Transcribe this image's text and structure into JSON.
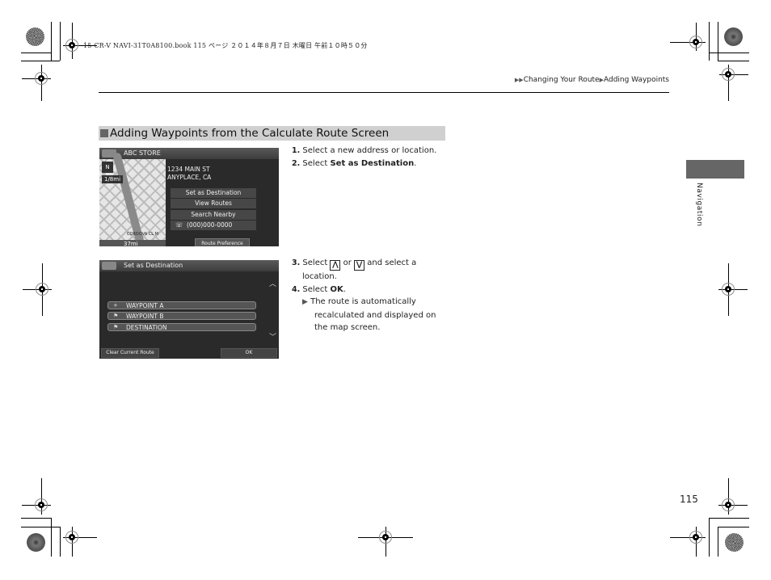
{
  "print_slug": "15 CR-V NAVI-31T0A8100.book  115 ページ  ２０１４年８月７日  木曜日  午前１０時５０分",
  "breadcrumb": {
    "items": [
      "Changing Your Route",
      "Adding Waypoints"
    ]
  },
  "section": {
    "title": "Adding Waypoints from the Calculate Route Screen"
  },
  "screen1": {
    "header_title": "ABC STORE",
    "map": {
      "north_label": "N",
      "zoom_scale": "1/8mi",
      "street_name": "CORDOVA CL M",
      "bottom_scale": "37mi"
    },
    "address_line1": "1234 MAIN ST",
    "address_line2": "ANYPLACE, CA",
    "menu": [
      {
        "label": "Set as Destination"
      },
      {
        "label": "View Routes"
      },
      {
        "label": "Search Nearby"
      },
      {
        "label": "(000)000-0000",
        "icon": "phone-icon"
      }
    ],
    "route_preference_label": "Route Preference"
  },
  "screen2": {
    "header_title": "Set as Destination",
    "list": [
      {
        "label": "WAYPOINT A",
        "icon": "+"
      },
      {
        "label": "WAYPOINT B",
        "icon": "flag"
      },
      {
        "label": "DESTINATION",
        "icon": "flag"
      }
    ],
    "clear_route_label": "Clear Current Route",
    "ok_label": "OK"
  },
  "steps_block1": {
    "step1_num": "1.",
    "step1_text": "Select a new address or location.",
    "step2_num": "2.",
    "step2_prefix": "Select ",
    "step2_bold": "Set as Destination",
    "step2_suffix": "."
  },
  "steps_block2": {
    "step3_num": "3.",
    "step3_prefix": "Select",
    "step3_up_key": "⋀",
    "step3_or": "or",
    "step3_down_key": "⋁",
    "step3_suffix": "and select a",
    "step3_line2": "location.",
    "step4_num": "4.",
    "step4_prefix": "Select ",
    "step4_bold": "OK",
    "step4_suffix": ".",
    "result_line1": "The route is automatically",
    "result_line2": "recalculated and displayed on",
    "result_line3": "the map screen."
  },
  "side_tab": {
    "label": "Navigation"
  },
  "page_number": "115"
}
